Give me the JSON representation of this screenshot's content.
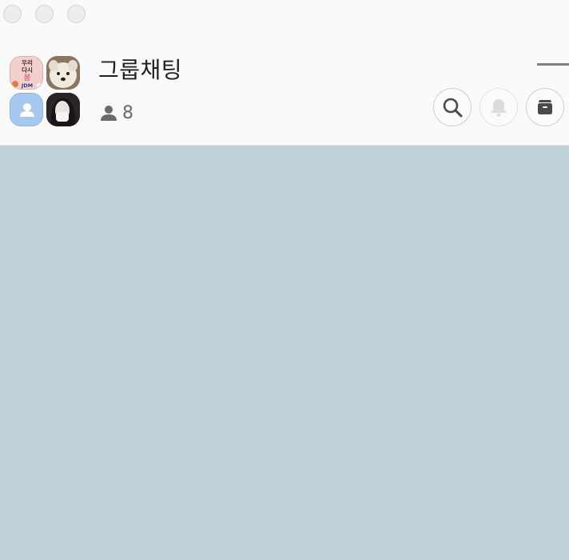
{
  "window": {
    "controls": [
      "close",
      "minimize",
      "maximize"
    ]
  },
  "chat": {
    "title": "그룹채팅",
    "member_count": "8",
    "avatar_1_text": [
      "우리",
      "다시",
      "봄",
      "JDM"
    ]
  },
  "toolbar": {
    "search_icon": "search-icon",
    "bell_icon": "bell-icon",
    "archive_icon": "archive-icon"
  },
  "colors": {
    "chat_background": "#c1d1da",
    "header_background": "#fafafa"
  }
}
